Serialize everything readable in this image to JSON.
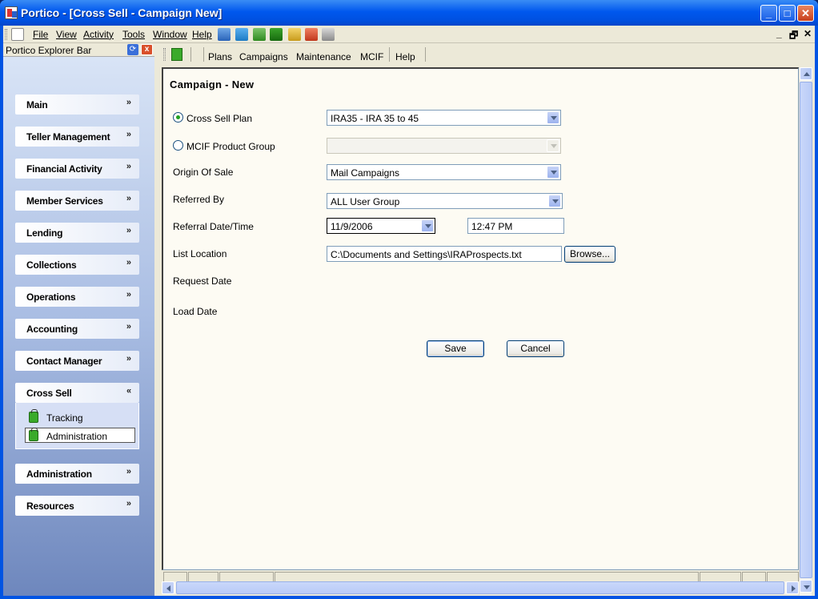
{
  "window": {
    "title": "Portico - [Cross Sell - Campaign New]",
    "min_label": "_",
    "max_label": "□",
    "close_label": "✕"
  },
  "menubar": {
    "items": [
      "File",
      "View",
      "Activity",
      "Tools",
      "Window",
      "Help"
    ],
    "mdi_min": "_",
    "mdi_restore": "🗗",
    "mdi_close": "✕"
  },
  "explorer": {
    "title": "Portico Explorer Bar",
    "groups": [
      {
        "label": "Main",
        "expanded": false
      },
      {
        "label": "Teller Management",
        "expanded": false
      },
      {
        "label": "Financial Activity",
        "expanded": false
      },
      {
        "label": "Member Services",
        "expanded": false
      },
      {
        "label": "Lending",
        "expanded": false
      },
      {
        "label": "Collections",
        "expanded": false
      },
      {
        "label": "Operations",
        "expanded": false
      },
      {
        "label": "Accounting",
        "expanded": false
      },
      {
        "label": "Contact Manager",
        "expanded": false
      },
      {
        "label": "Cross Sell",
        "expanded": true
      },
      {
        "label": "Administration",
        "expanded": false
      },
      {
        "label": "Resources",
        "expanded": false
      }
    ],
    "cross_sell_items": [
      {
        "label": "Tracking",
        "selected": false
      },
      {
        "label": "Administration",
        "selected": true
      }
    ]
  },
  "toolbar": {
    "links": [
      "Plans",
      "Campaigns",
      "Maintenance",
      "MCIF",
      "Help"
    ]
  },
  "form": {
    "title": "Campaign - New",
    "cross_sell_plan": {
      "label": "Cross Sell Plan",
      "selected": true,
      "value": "IRA35 - IRA 35 to 45"
    },
    "mcif_group": {
      "label": "MCIF Product Group",
      "selected": false,
      "value": ""
    },
    "origin_of_sale": {
      "label": "Origin Of Sale",
      "value": "Mail Campaigns"
    },
    "referred_by": {
      "label": "Referred By",
      "value": "ALL User Group"
    },
    "referral_datetime": {
      "label": "Referral Date/Time",
      "date": "11/9/2006",
      "time": "12:47 PM"
    },
    "list_location": {
      "label": "List Location",
      "value": "C:\\Documents and Settings\\IRAProspects.txt",
      "browse_label": "Browse..."
    },
    "request_date": {
      "label": "Request Date"
    },
    "load_date": {
      "label": "Load Date"
    },
    "save_label": "Save",
    "cancel_label": "Cancel"
  },
  "colors": {
    "titlebar": "#0054e3",
    "radio_selected": "#21a121",
    "pane_bg": "#fdfbf3"
  }
}
